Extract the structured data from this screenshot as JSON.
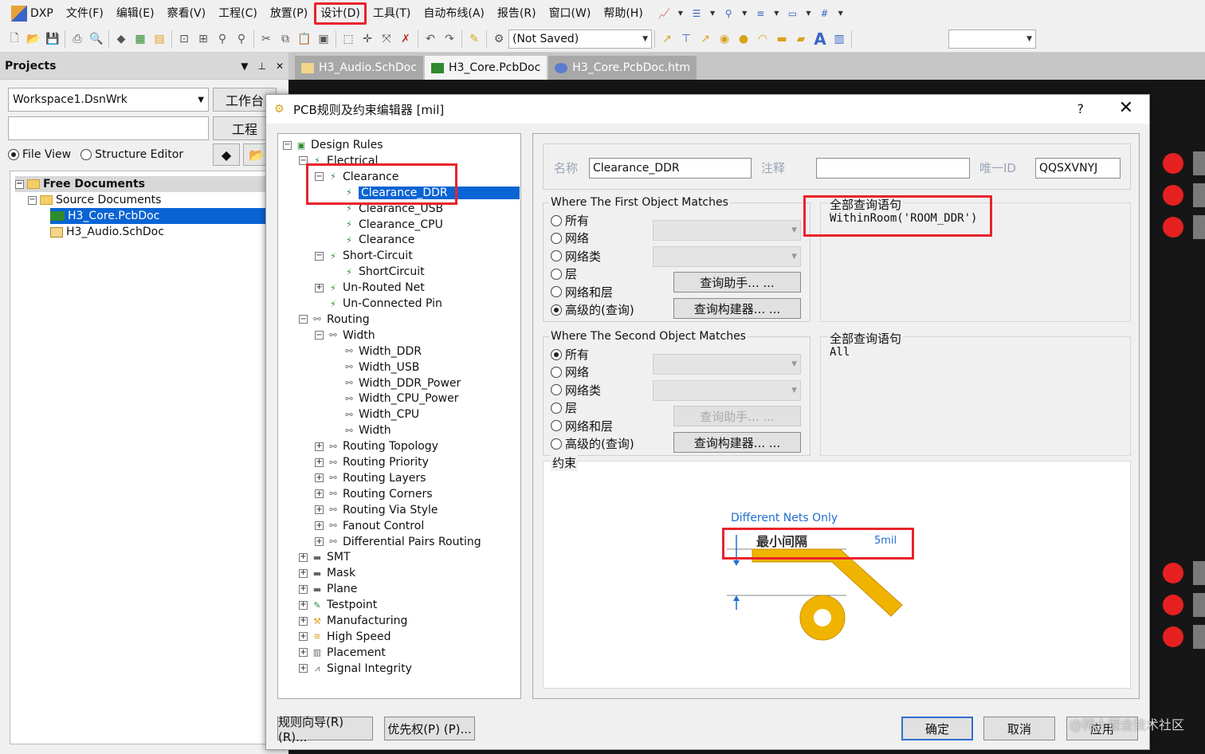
{
  "menu": {
    "app": "DXP",
    "items": [
      "文件(F)",
      "编辑(E)",
      "察看(V)",
      "工程(C)",
      "放置(P)",
      "设计(D)",
      "工具(T)",
      "自动布线(A)",
      "报告(R)",
      "窗口(W)",
      "帮助(H)"
    ],
    "highlighted_index": 5
  },
  "toolbar": {
    "save_state": "(Not Saved)",
    "right_combo": ""
  },
  "projects": {
    "title": "Projects",
    "workspace": "Workspace1.DsnWrk",
    "workspace_btn": "工作台",
    "project_btn": "工程",
    "view_options": [
      "File View",
      "Structure Editor"
    ],
    "view_selected": 0,
    "tree": {
      "root": "Free Documents",
      "group": "Source Documents",
      "docs": [
        "H3_Core.PcbDoc",
        "H3_Audio.SchDoc"
      ]
    }
  },
  "doc_tabs": [
    "H3_Audio.SchDoc",
    "H3_Core.PcbDoc",
    "H3_Core.PcbDoc.htm"
  ],
  "doc_tab_active": 1,
  "dialog": {
    "title": "PCB规则及约束编辑器 [mil]",
    "help": "?",
    "close": "✕",
    "tree": [
      {
        "label": "Design Rules",
        "level": 0,
        "exp": "−"
      },
      {
        "label": "Electrical",
        "level": 1,
        "exp": "−"
      },
      {
        "label": "Clearance",
        "level": 2,
        "exp": "−"
      },
      {
        "label": "Clearance_DDR",
        "level": 3,
        "selected": true
      },
      {
        "label": "Clearance_USB",
        "level": 3
      },
      {
        "label": "Clearance_CPU",
        "level": 3
      },
      {
        "label": "Clearance",
        "level": 3
      },
      {
        "label": "Short-Circuit",
        "level": 2,
        "exp": "−"
      },
      {
        "label": "ShortCircuit",
        "level": 3
      },
      {
        "label": "Un-Routed Net",
        "level": 2,
        "exp": "+"
      },
      {
        "label": "Un-Connected Pin",
        "level": 2
      },
      {
        "label": "Routing",
        "level": 1,
        "exp": "−"
      },
      {
        "label": "Width",
        "level": 2,
        "exp": "−"
      },
      {
        "label": "Width_DDR",
        "level": 3
      },
      {
        "label": "Width_USB",
        "level": 3
      },
      {
        "label": "Width_DDR_Power",
        "level": 3
      },
      {
        "label": "Width_CPU_Power",
        "level": 3
      },
      {
        "label": "Width_CPU",
        "level": 3
      },
      {
        "label": "Width",
        "level": 3
      },
      {
        "label": "Routing Topology",
        "level": 2,
        "exp": "+"
      },
      {
        "label": "Routing Priority",
        "level": 2,
        "exp": "+"
      },
      {
        "label": "Routing Layers",
        "level": 2,
        "exp": "+"
      },
      {
        "label": "Routing Corners",
        "level": 2,
        "exp": "+"
      },
      {
        "label": "Routing Via Style",
        "level": 2,
        "exp": "+"
      },
      {
        "label": "Fanout Control",
        "level": 2,
        "exp": "+"
      },
      {
        "label": "Differential Pairs Routing",
        "level": 2,
        "exp": "+"
      },
      {
        "label": "SMT",
        "level": 1,
        "exp": "+"
      },
      {
        "label": "Mask",
        "level": 1,
        "exp": "+"
      },
      {
        "label": "Plane",
        "level": 1,
        "exp": "+"
      },
      {
        "label": "Testpoint",
        "level": 1,
        "exp": "+"
      },
      {
        "label": "Manufacturing",
        "level": 1,
        "exp": "+"
      },
      {
        "label": "High Speed",
        "level": 1,
        "exp": "+"
      },
      {
        "label": "Placement",
        "level": 1,
        "exp": "+"
      },
      {
        "label": "Signal Integrity",
        "level": 1,
        "exp": "+"
      }
    ],
    "rule": {
      "name_label": "名称",
      "name_value": "Clearance_DDR",
      "comment_label": "注释",
      "comment_value": "",
      "uid_label": "唯一ID",
      "uid_value": "QQSXVNYJ"
    },
    "first": {
      "title": "Where The First Object Matches",
      "options": [
        "所有",
        "网络",
        "网络类",
        "层",
        "网络和层",
        "高级的(查询)"
      ],
      "selected": 5,
      "helper_btn": "查询助手... ...",
      "builder_btn": "查询构建器... ...",
      "query_title": "全部查询语句",
      "query": "WithinRoom('ROOM_DDR')"
    },
    "second": {
      "title": "Where The Second Object Matches",
      "options": [
        "所有",
        "网络",
        "网络类",
        "层",
        "网络和层",
        "高级的(查询)"
      ],
      "selected": 0,
      "helper_btn": "查询助手... ...",
      "builder_btn": "查询构建器... ...",
      "query_title": "全部查询语句",
      "query": "All"
    },
    "constraint": {
      "title": "约束",
      "mode": "Different Nets Only",
      "min_label": "最小间隔",
      "min_value": "5mil"
    },
    "buttons": {
      "wizard": "规则向导(R) (R)...",
      "priority": "优先权(P) (P)...",
      "ok": "确定",
      "cancel": "取消",
      "apply": "应用"
    }
  },
  "watermark": "@稀土掘金技术社区",
  "colors": {
    "highlight_red": "#e8232b",
    "selection_blue": "#0a64d4",
    "track_gold": "#f0b400",
    "link_blue": "#1f6fd0"
  }
}
